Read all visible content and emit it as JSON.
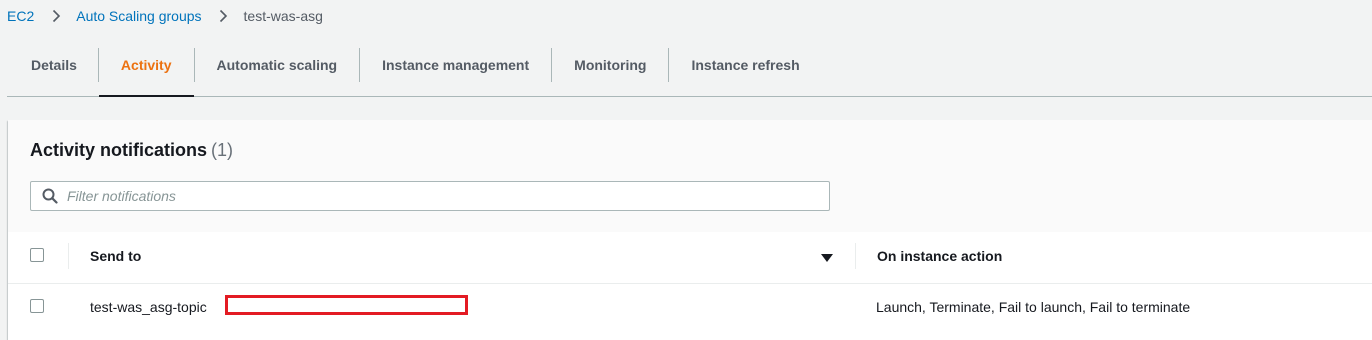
{
  "breadcrumb": {
    "items": [
      "EC2",
      "Auto Scaling groups"
    ],
    "current": "test-was-asg"
  },
  "tabs": [
    {
      "label": "Details",
      "active": false
    },
    {
      "label": "Activity",
      "active": true
    },
    {
      "label": "Automatic scaling",
      "active": false
    },
    {
      "label": "Instance management",
      "active": false
    },
    {
      "label": "Monitoring",
      "active": false
    },
    {
      "label": "Instance refresh",
      "active": false
    }
  ],
  "panel": {
    "title": "Activity notifications",
    "count": "(1)",
    "filter": {
      "placeholder": "Filter notifications",
      "value": ""
    }
  },
  "table": {
    "columns": [
      "Send to",
      "On instance action"
    ],
    "rows": [
      {
        "send_to": "test-was_asg-topic",
        "on_instance_action": "Launch, Terminate, Fail to launch, Fail to terminate",
        "selected": false
      }
    ]
  },
  "icons": {
    "breadcrumb_separator": "chevron-right-icon",
    "filter": "search-icon",
    "sort": "caret-down-icon"
  },
  "colors": {
    "link": "#0073bb",
    "active_tab": "#ec7211",
    "redaction": "#e31b23"
  }
}
